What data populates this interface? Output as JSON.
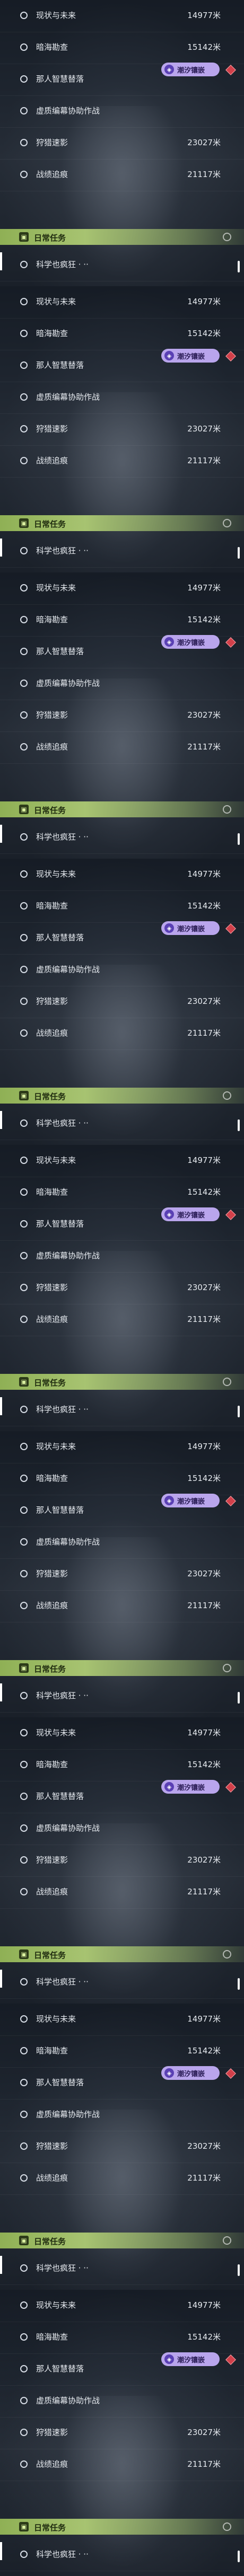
{
  "quests": [
    {
      "name": "现状与未来",
      "distance": "14977米"
    },
    {
      "name": "暗海勘查",
      "distance": "15142米"
    },
    {
      "name": "那人智慧替落",
      "distance": ""
    },
    {
      "name": "虚质编幕协助作战",
      "distance": ""
    },
    {
      "name": "狩猎速影",
      "distance": "23027米"
    },
    {
      "name": "战绩追痕",
      "distance": "21117米"
    }
  ],
  "badge": {
    "label": "潮汐镶嵌",
    "icon": "tide-emblem-icon"
  },
  "category": {
    "label": "日常任务",
    "icon": "calendar-icon"
  },
  "daily": {
    "name": "科学也疯狂 · ··"
  },
  "colors": {
    "accent": "#a7c371",
    "badge": "#b9a5ec",
    "marker": "#d2404a"
  }
}
